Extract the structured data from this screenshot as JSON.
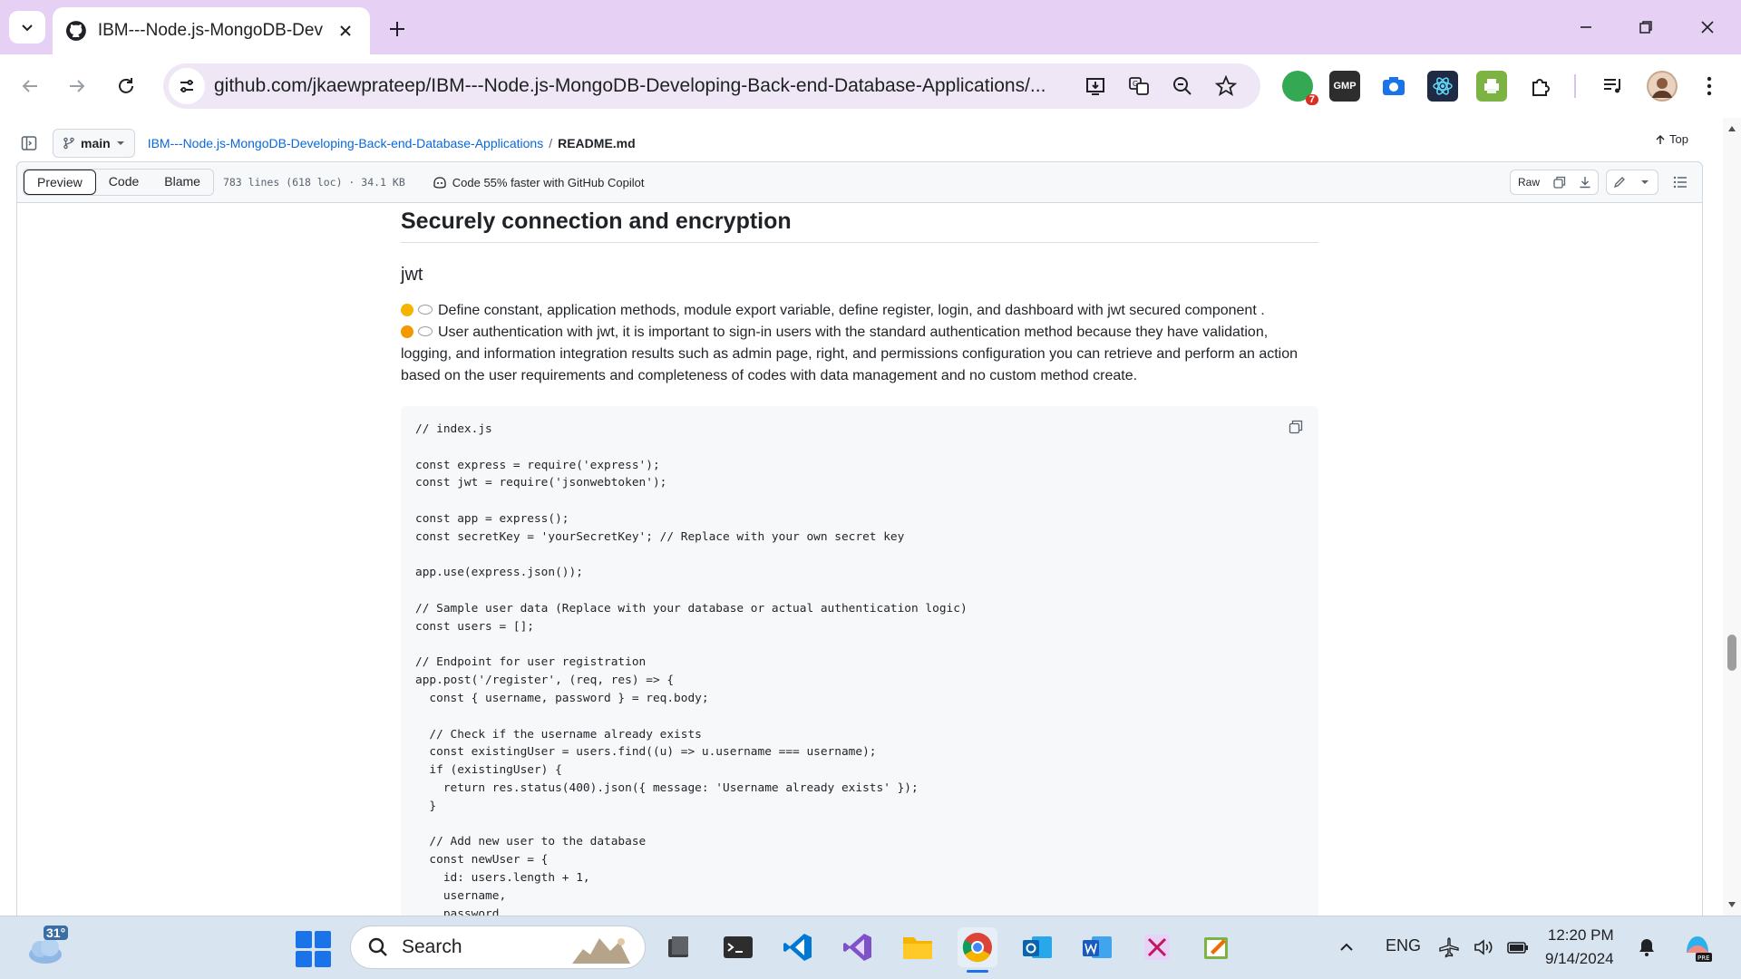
{
  "browser": {
    "tab_title": "IBM---Node.js-MongoDB-Developing-Back-end-Database-Applications",
    "url": "github.com/jkaewprateep/IBM---Node.js-MongoDB-Developing-Back-end-Database-Applications/...",
    "extension_badge_count": "7",
    "extension_gmp_label": "GMP"
  },
  "repo_header": {
    "branch": "main",
    "repo_link": "IBM---Node.js-MongoDB-Developing-Back-end-Database-Applications",
    "separator": "/",
    "file_name": "README.md",
    "top_label": "Top"
  },
  "view_bar": {
    "tabs": [
      "Preview",
      "Code",
      "Blame"
    ],
    "active_tab": "Preview",
    "file_meta": "783 lines (618 loc) · 34.1 KB",
    "copilot_text": "Code 55% faster with GitHub Copilot",
    "raw_label": "Raw"
  },
  "readme": {
    "heading": "Securely connection and encryption",
    "subheading": "jwt",
    "line1": "Define constant, application methods, module export variable, define register, login, and dashboard with jwt secured component .",
    "line2": "User authentication with jwt, it is important to sign-in users with the standard authentication method because they have validation, logging, and information integration results such as admin page, right, and permissions configuration you can retrieve and perform an action based on the user requirements and completeness of codes with data management and no custom method create.",
    "code": "// index.js\n\nconst express = require('express');\nconst jwt = require('jsonwebtoken');\n\nconst app = express();\nconst secretKey = 'yourSecretKey'; // Replace with your own secret key\n\napp.use(express.json());\n\n// Sample user data (Replace with your database or actual authentication logic)\nconst users = [];\n\n// Endpoint for user registration\napp.post('/register', (req, res) => {\n  const { username, password } = req.body;\n\n  // Check if the username already exists\n  const existingUser = users.find((u) => u.username === username);\n  if (existingUser) {\n    return res.status(400).json({ message: 'Username already exists' });\n  }\n\n  // Add new user to the database\n  const newUser = {\n    id: users.length + 1,\n    username,\n    password"
  },
  "taskbar": {
    "temperature": "31°",
    "search_label": "Search",
    "language": "ENG",
    "time": "12:20 PM",
    "date": "9/14/2024"
  },
  "colors": {
    "chrome_frame": "#e6d1f5",
    "link": "#0969da",
    "code_bg": "#f6f8fa"
  }
}
